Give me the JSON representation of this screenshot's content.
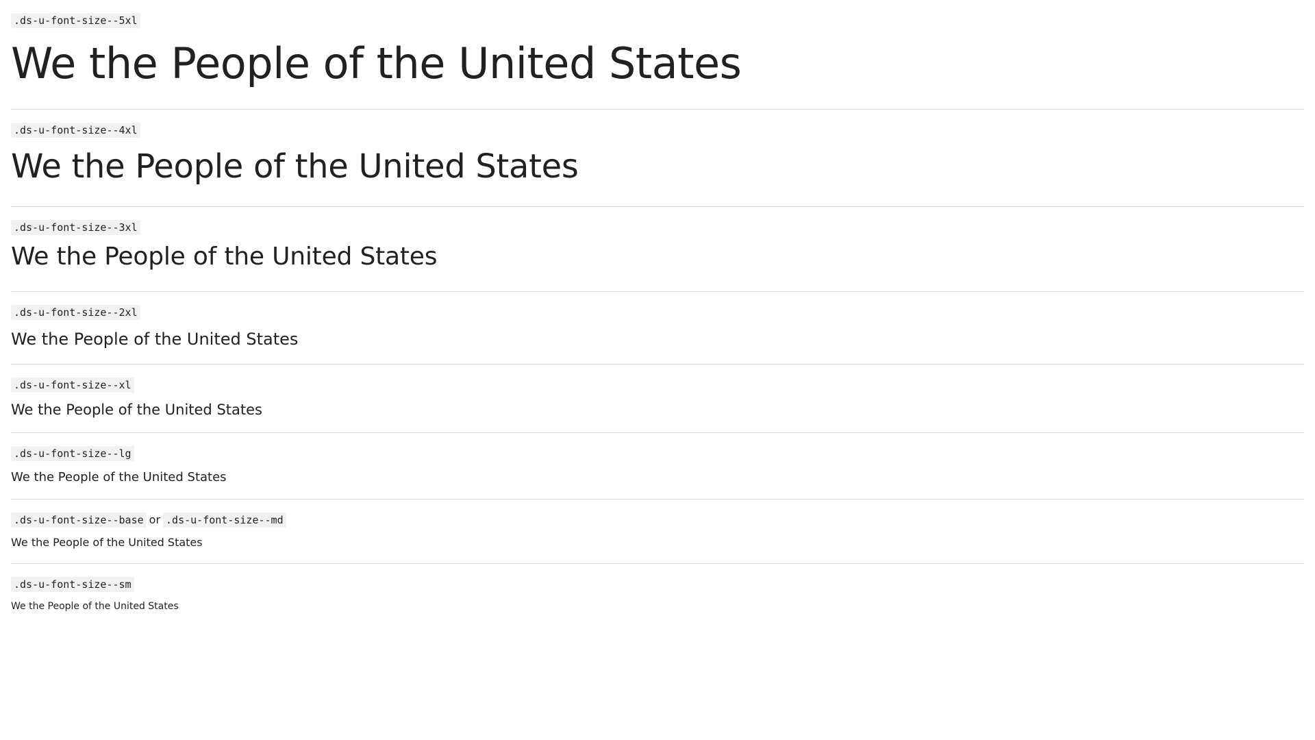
{
  "samples": {
    "s5xl": {
      "class_label": ".ds-u-font-size--5xl",
      "text": "We the People of the United States"
    },
    "s4xl": {
      "class_label": ".ds-u-font-size--4xl",
      "text": "We the People of the United States"
    },
    "s3xl": {
      "class_label": ".ds-u-font-size--3xl",
      "text": "We the People of the United States"
    },
    "s2xl": {
      "class_label": ".ds-u-font-size--2xl",
      "text": "We the People of the United States"
    },
    "sxl": {
      "class_label": ".ds-u-font-size--xl",
      "text": "We the People of the United States"
    },
    "slg": {
      "class_label": ".ds-u-font-size--lg",
      "text": "We the People of the United States"
    },
    "sbase": {
      "class_label": ".ds-u-font-size--base",
      "or_text": "or",
      "class_label_alt": ".ds-u-font-size--md",
      "text": "We the People of the United States"
    },
    "ssm": {
      "class_label": ".ds-u-font-size--sm",
      "text": "We the People of the United States"
    }
  },
  "colors": {
    "text": "#212121",
    "code_background": "#f1f1f1",
    "divider": "#d6d7d9"
  }
}
